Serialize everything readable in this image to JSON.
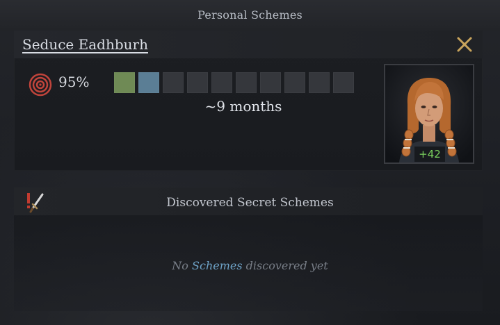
{
  "header": {
    "title": "Personal Schemes"
  },
  "scheme": {
    "title": "Seduce Eadhburh",
    "success_chance": "95%",
    "duration": "~9 months",
    "progress": {
      "total_steps": 10,
      "completed_steps": 2,
      "step_colors": [
        "#6f8a55",
        "#5b7e95",
        "#35373c",
        "#35373c",
        "#35373c",
        "#35373c",
        "#35373c",
        "#35373c",
        "#35373c",
        "#35373c"
      ]
    },
    "target": {
      "opinion": "+42",
      "opinion_color": "#7bd35e"
    },
    "icons": {
      "success": "target-icon",
      "close": "close-icon",
      "portrait": "character-portrait"
    }
  },
  "discovered": {
    "title": "Discovered Secret Schemes",
    "icon": "dagger-alert-icon",
    "empty_prefix": "No",
    "empty_keyword": "Schemes",
    "empty_suffix": "discovered yet"
  },
  "colors": {
    "accent_gold": "#c9a45c",
    "success_red": "#c0443b",
    "link_blue": "#6fa4c9"
  }
}
